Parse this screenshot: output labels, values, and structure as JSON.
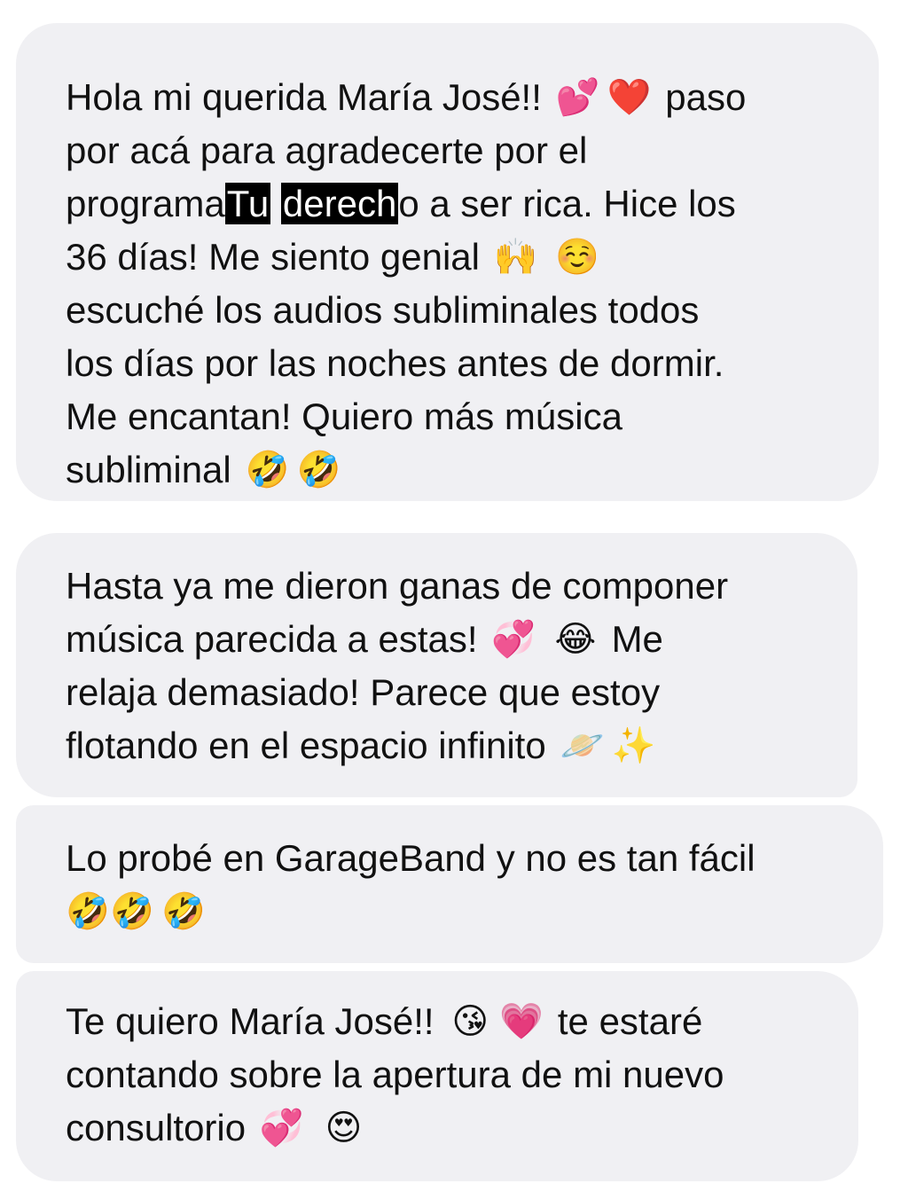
{
  "messages": [
    {
      "lines": [
        [
          "Hola mi querida María José!! ",
          "💕",
          "❤️",
          " paso"
        ],
        [
          "por acá para agradecerte por el"
        ],
        [
          "programa",
          "Tu",
          " ",
          "derech",
          "o a ser rica. Hice los"
        ],
        [
          "36 días! Me siento genial ",
          "🙌",
          " ",
          "☺️"
        ],
        [
          "escuché los audios subliminales todos"
        ],
        [
          "los días por las noches antes de dormir."
        ],
        [
          "Me encantan! Quiero más música"
        ],
        [
          "subliminal ",
          "🤣",
          "🤣"
        ]
      ]
    },
    {
      "lines": [
        [
          "Hasta ya me dieron ganas de componer"
        ],
        [
          "música parecida a estas! ",
          "💞",
          " ",
          "😂",
          " Me"
        ],
        [
          "relaja demasiado! Parece que estoy"
        ],
        [
          "flotando en el espacio infinito ",
          "🪐",
          "✨"
        ]
      ]
    },
    {
      "lines": [
        [
          "Lo probé en GarageBand y no es tan fácil"
        ],
        [
          "🤣",
          "🤣",
          "🤣"
        ]
      ]
    },
    {
      "lines": [
        [
          "Te quiero María José!! ",
          "😘",
          "💗",
          " te estaré"
        ],
        [
          "contando sobre la apertura de mi nuevo"
        ],
        [
          "consultorio ",
          "💞",
          " ",
          "😍"
        ]
      ]
    }
  ],
  "colors": {
    "bubble": "#f0f0f3",
    "text": "#111111",
    "redaction": "#000000"
  }
}
